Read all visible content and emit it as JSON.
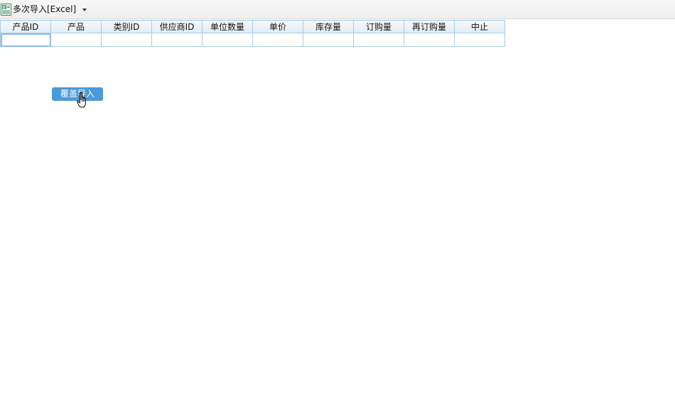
{
  "toolbar": {
    "import_menu_label": "多次导入[Excel]"
  },
  "grid": {
    "columns": [
      "产品ID",
      "产品",
      "类别ID",
      "供应商ID",
      "单位数量",
      "单价",
      "库存量",
      "订购量",
      "再订购量",
      "中止"
    ]
  },
  "actions": {
    "cover_import_label": "覆盖导入"
  },
  "colors": {
    "button_bg": "#4a9ad8",
    "grid_border": "#a9cbe6",
    "excel_icon": "#2e8b57"
  },
  "icons": {
    "import": "excel-file-icon",
    "menu": "chevron-down-icon",
    "cursor": "hand-pointer-icon"
  }
}
